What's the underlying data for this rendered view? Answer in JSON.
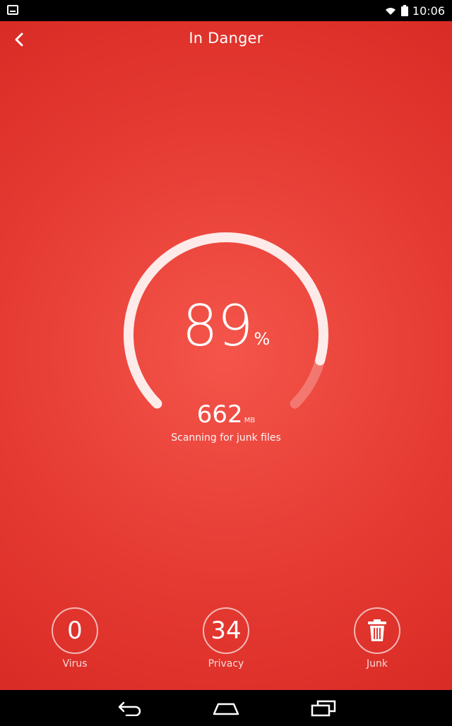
{
  "status_bar": {
    "time": "10:06",
    "icons": [
      "image-icon",
      "wifi-icon",
      "battery-icon"
    ]
  },
  "header": {
    "title": "In Danger",
    "back_icon": "chevron-left-icon"
  },
  "gauge": {
    "percent_value": "89",
    "percent_unit": "%",
    "progress": 0.89,
    "size_value": "662",
    "size_unit": "MB",
    "status_text": "Scanning for junk files"
  },
  "stats": [
    {
      "name": "virus",
      "value": "0",
      "label": "Virus"
    },
    {
      "name": "privacy",
      "value": "34",
      "label": "Privacy"
    },
    {
      "name": "junk",
      "value": "",
      "label": "Junk",
      "icon": "trash-icon"
    }
  ],
  "colors": {
    "background": "#e53b33",
    "accent": "#ffffff",
    "status_bar": "#000000"
  },
  "nav": {
    "icons": [
      "back-icon",
      "home-icon",
      "recents-icon"
    ]
  }
}
